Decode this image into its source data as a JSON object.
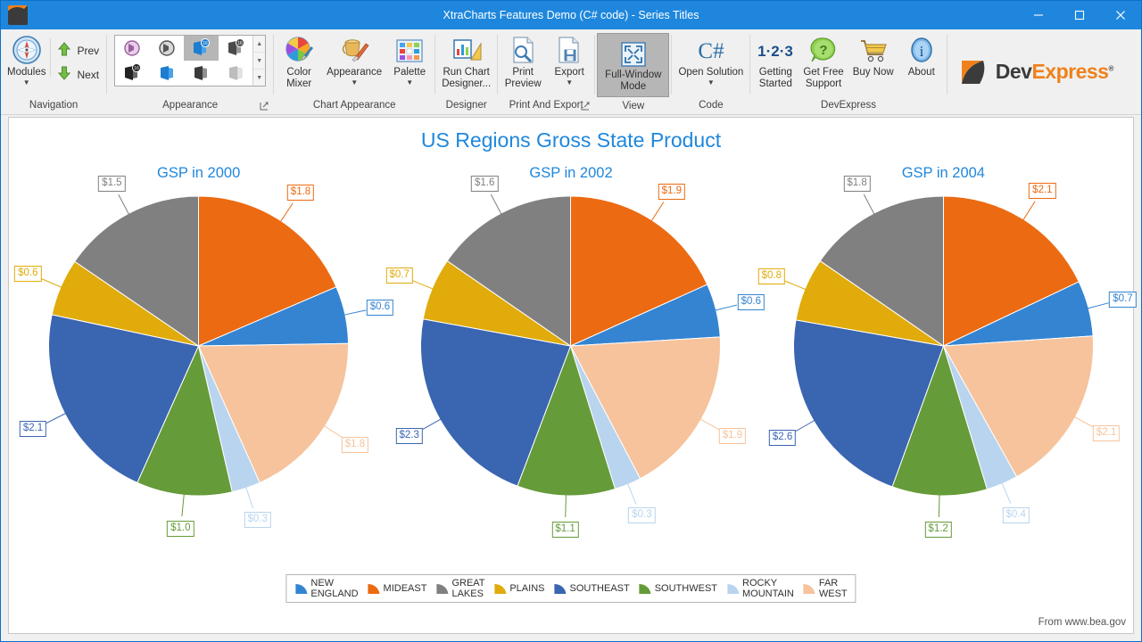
{
  "titlebar": {
    "title": "XtraCharts Features Demo (C# code) - Series Titles",
    "logo_icon": "devexpress-app-icon",
    "minimize_icon": "minimize-icon",
    "maximize_icon": "maximize-icon",
    "close_icon": "close-icon"
  },
  "ribbon": {
    "groups": [
      {
        "label": "Navigation",
        "buttons": [
          {
            "label": "Modules",
            "icon": "compass-icon",
            "caret": "▼"
          },
          {
            "label": "Prev",
            "icon": "arrow-up-green-icon"
          },
          {
            "label": "Next",
            "icon": "arrow-down-green-icon"
          }
        ]
      },
      {
        "label": "Appearance",
        "gallery": {
          "selected_index": 2,
          "items": [
            "office-2010-purple-icon",
            "office-2010-black-icon",
            "office-2016-colorful-icon",
            "office-2016-dark-gray-icon",
            "office-2016-black-icon",
            "office-2019-colorful-icon",
            "office-2019-dark-gray-icon",
            "office-2019-white-icon"
          ],
          "scroll_up": "▲",
          "scroll_down": "▼",
          "scroll_more": "▼"
        },
        "dialog_launcher": "dialog-box-launcher-icon"
      },
      {
        "label": "Chart Appearance",
        "buttons": [
          {
            "label": "Color\nMixer",
            "icon": "color-mixer-icon"
          },
          {
            "label": "Appearance",
            "icon": "appearance-paint-icon",
            "caret": "▼"
          },
          {
            "label": "Palette",
            "icon": "palette-grid-icon",
            "caret": "▼"
          }
        ]
      },
      {
        "label": "Designer",
        "buttons": [
          {
            "label": "Run Chart\nDesigner...",
            "icon": "chart-designer-icon"
          }
        ]
      },
      {
        "label": "Print And Export",
        "buttons": [
          {
            "label": "Print\nPreview",
            "icon": "print-preview-icon"
          },
          {
            "label": "Export",
            "icon": "export-icon",
            "caret": "▼"
          }
        ],
        "dialog_launcher": "dialog-box-launcher-icon"
      },
      {
        "label": "View",
        "buttons": [
          {
            "label": "Full-Window\nMode",
            "icon": "full-window-mode-icon",
            "selected": true
          }
        ]
      },
      {
        "label": "Code",
        "buttons": [
          {
            "label": "Open Solution",
            "icon": "csharp-icon",
            "caret": "▼"
          }
        ]
      },
      {
        "label": "DevExpress",
        "buttons": [
          {
            "label": "Getting\nStarted",
            "icon": "123-icon"
          },
          {
            "label": "Get Free\nSupport",
            "icon": "support-balloon-icon"
          },
          {
            "label": "Buy Now",
            "icon": "shopping-cart-icon"
          },
          {
            "label": "About",
            "icon": "info-icon"
          }
        ]
      }
    ],
    "brand": {
      "name_part1": "Dev",
      "name_part2": "Express",
      "trademark": "®",
      "mark_icon": "devexpress-logo-icon"
    }
  },
  "chart_data": {
    "type": "pie",
    "title": "US Regions Gross State Product",
    "source_note": "From www.bea.gov",
    "legend_position": "bottom",
    "labels": [
      "NEW ENGLAND",
      "MIDEAST",
      "GREAT LAKES",
      "PLAINS",
      "SOUTHEAST",
      "SOUTHWEST",
      "ROCKY MOUNTAIN",
      "FAR WEST"
    ],
    "colors": [
      "#3484d2",
      "#ec6a11",
      "#808080",
      "#e0ab0b",
      "#3a65b0",
      "#659b39",
      "#b9d4ee",
      "#f6c39c"
    ],
    "charts": [
      {
        "title": "GSP in 2000",
        "slices": [
          {
            "label": "MIDEAST",
            "value": 1.8,
            "display": "$1.8",
            "color": "#ec6a11"
          },
          {
            "label": "NEW ENGLAND",
            "value": 0.6,
            "display": "$0.6",
            "color": "#3484d2"
          },
          {
            "label": "FAR WEST",
            "value": 1.8,
            "display": "$1.8",
            "color": "#f6c39c"
          },
          {
            "label": "ROCKY MOUNTAIN",
            "value": 0.3,
            "display": "$0.3",
            "color": "#b9d4ee"
          },
          {
            "label": "SOUTHWEST",
            "value": 1.0,
            "display": "$1.0",
            "color": "#659b39"
          },
          {
            "label": "SOUTHEAST",
            "value": 2.1,
            "display": "$2.1",
            "color": "#3a65b0"
          },
          {
            "label": "PLAINS",
            "value": 0.6,
            "display": "$0.6",
            "color": "#e0ab0b"
          },
          {
            "label": "GREAT LAKES",
            "value": 1.5,
            "display": "$1.5",
            "color": "#808080"
          }
        ]
      },
      {
        "title": "GSP in 2002",
        "slices": [
          {
            "label": "MIDEAST",
            "value": 1.9,
            "display": "$1.9",
            "color": "#ec6a11"
          },
          {
            "label": "NEW ENGLAND",
            "value": 0.6,
            "display": "$0.6",
            "color": "#3484d2"
          },
          {
            "label": "FAR WEST",
            "value": 1.9,
            "display": "$1.9",
            "color": "#f6c39c"
          },
          {
            "label": "ROCKY MOUNTAIN",
            "value": 0.3,
            "display": "$0.3",
            "color": "#b9d4ee"
          },
          {
            "label": "SOUTHWEST",
            "value": 1.1,
            "display": "$1.1",
            "color": "#659b39"
          },
          {
            "label": "SOUTHEAST",
            "value": 2.3,
            "display": "$2.3",
            "color": "#3a65b0"
          },
          {
            "label": "PLAINS",
            "value": 0.7,
            "display": "$0.7",
            "color": "#e0ab0b"
          },
          {
            "label": "GREAT LAKES",
            "value": 1.6,
            "display": "$1.6",
            "color": "#808080"
          }
        ]
      },
      {
        "title": "GSP in 2004",
        "slices": [
          {
            "label": "MIDEAST",
            "value": 2.1,
            "display": "$2.1",
            "color": "#ec6a11"
          },
          {
            "label": "NEW ENGLAND",
            "value": 0.7,
            "display": "$0.7",
            "color": "#3484d2"
          },
          {
            "label": "FAR WEST",
            "value": 2.1,
            "display": "$2.1",
            "color": "#f6c39c"
          },
          {
            "label": "ROCKY MOUNTAIN",
            "value": 0.4,
            "display": "$0.4",
            "color": "#b9d4ee"
          },
          {
            "label": "SOUTHWEST",
            "value": 1.2,
            "display": "$1.2",
            "color": "#659b39"
          },
          {
            "label": "SOUTHEAST",
            "value": 2.6,
            "display": "$2.6",
            "color": "#3a65b0"
          },
          {
            "label": "PLAINS",
            "value": 0.8,
            "display": "$0.8",
            "color": "#e0ab0b"
          },
          {
            "label": "GREAT LAKES",
            "value": 1.8,
            "display": "$1.8",
            "color": "#808080"
          }
        ]
      }
    ]
  }
}
